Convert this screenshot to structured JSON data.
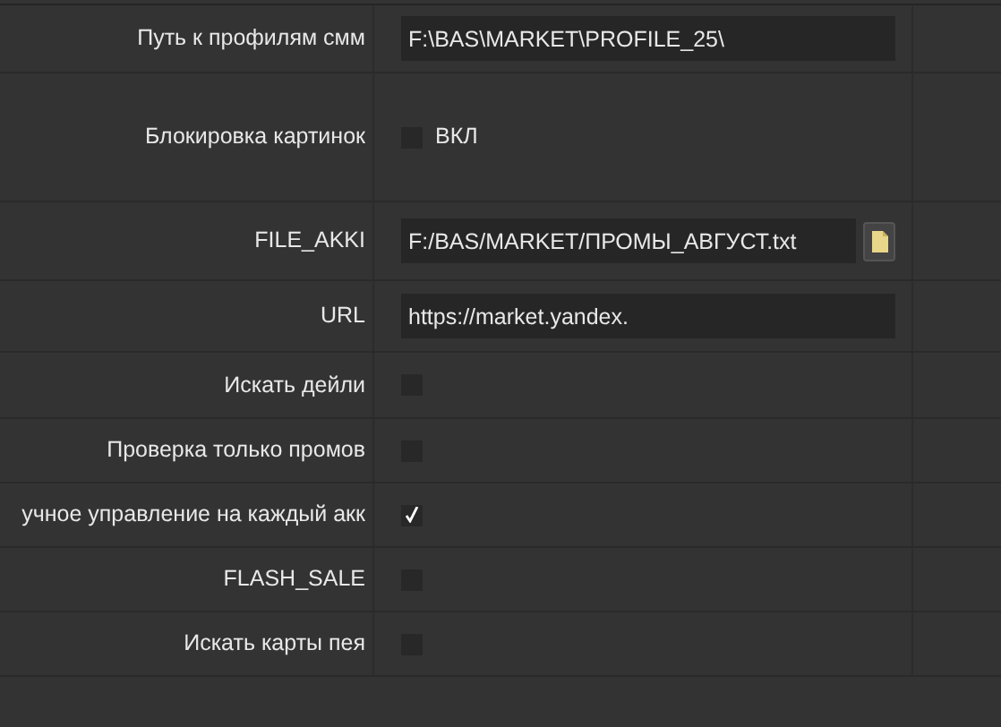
{
  "rows": [
    {
      "label": "Путь к профилям смм",
      "kind": "text",
      "value": "F:\\BAS\\MARKET\\PROFILE_25\\"
    },
    {
      "label": "Блокировка картинок",
      "kind": "checkbox",
      "checked": false,
      "caption": "ВКЛ"
    },
    {
      "label": "FILE_AKKI",
      "kind": "file",
      "value": "F:/BAS/MARKET/ПРОМЫ_АВГУСТ.txt"
    },
    {
      "label": "URL",
      "kind": "text",
      "value": "https://market.yandex."
    },
    {
      "label": "Искать дейли",
      "kind": "checkbox",
      "checked": false
    },
    {
      "label": "Проверка только промов",
      "kind": "checkbox",
      "checked": false
    },
    {
      "label": "учное управление на каждый акк",
      "kind": "checkbox",
      "checked": true
    },
    {
      "label": "FLASH_SALE",
      "kind": "checkbox",
      "checked": false
    },
    {
      "label": "Искать карты пея",
      "kind": "checkbox",
      "checked": false
    }
  ]
}
